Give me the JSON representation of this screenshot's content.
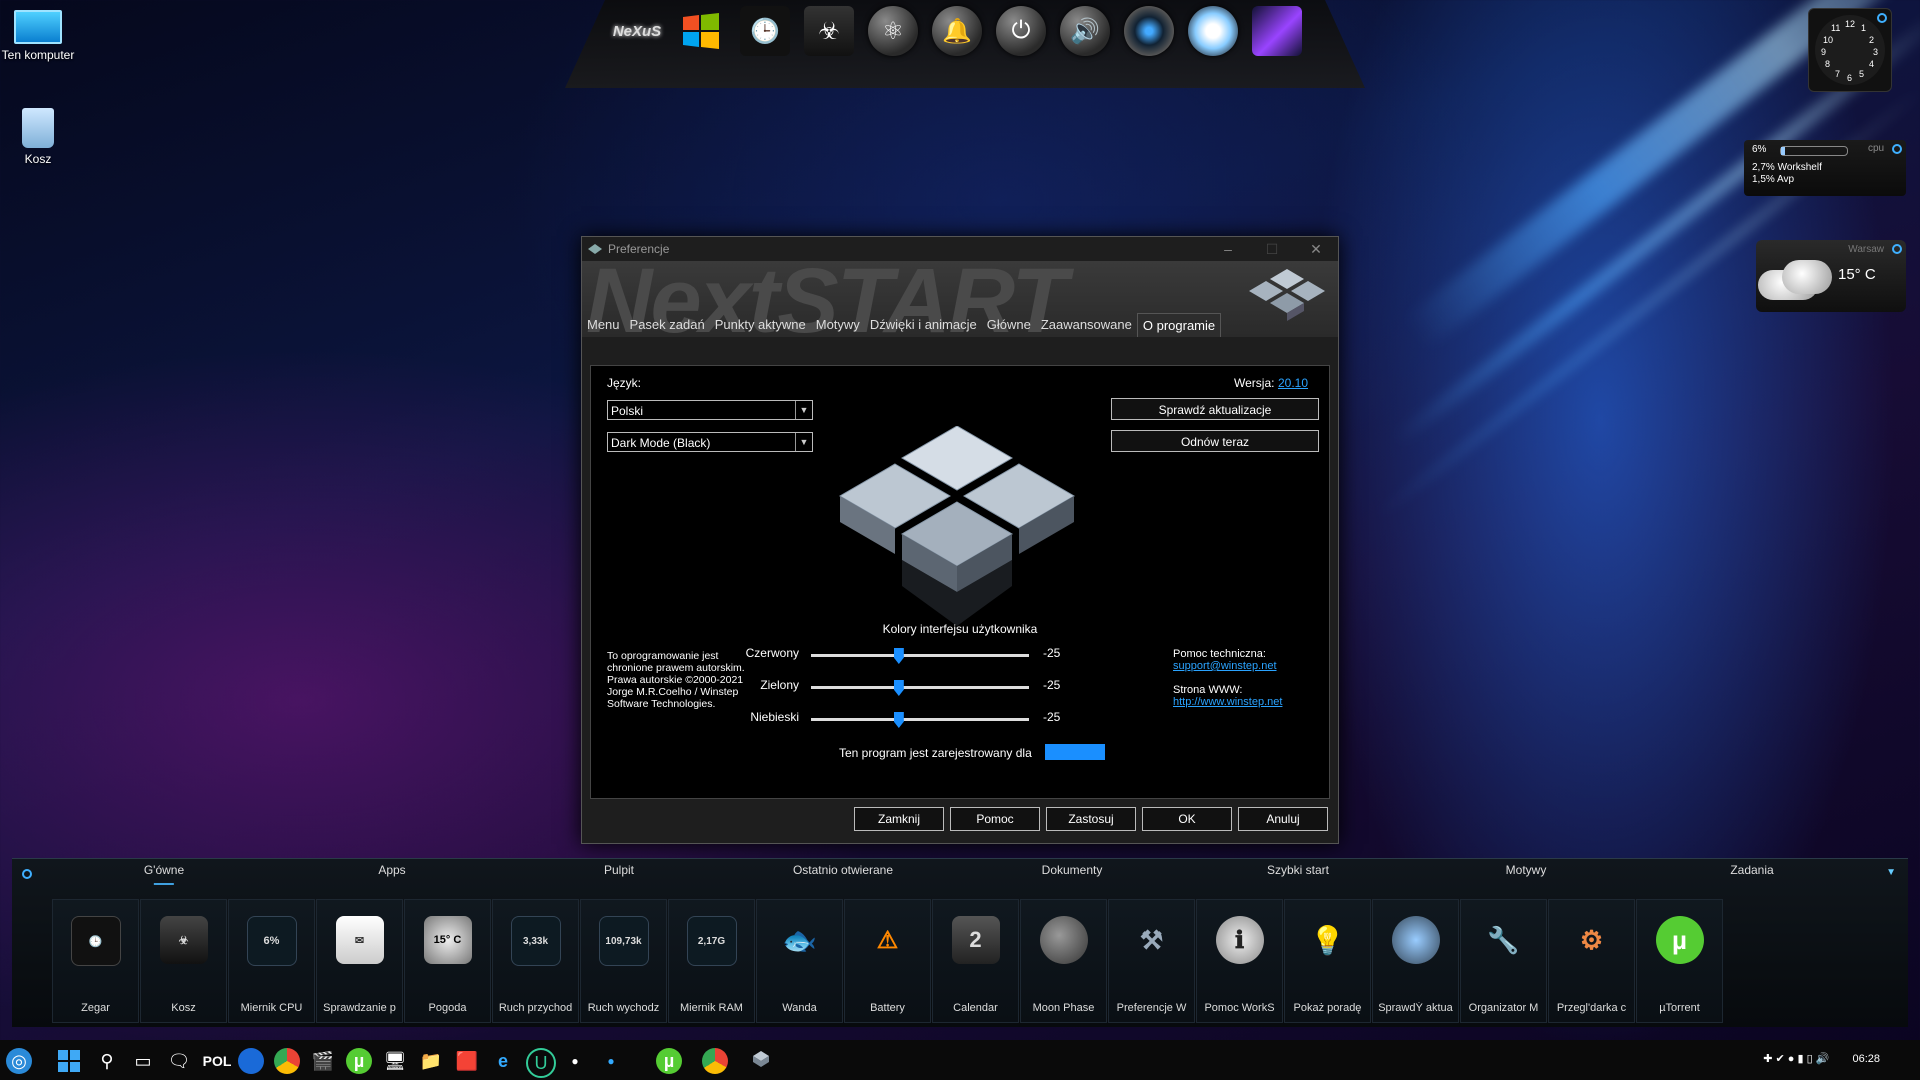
{
  "desktop": {
    "icons": [
      {
        "label": "Ten komputer"
      },
      {
        "label": "Kosz"
      }
    ]
  },
  "top_dock": {
    "items": [
      "Nexus",
      "Windows",
      "Clock",
      "Recycle",
      "Atom",
      "Bell",
      "Power",
      "Speaker",
      "Camera",
      "Compass",
      "Comet"
    ],
    "nexus_label": "NeXuS"
  },
  "clock_gadget": {
    "numbers": [
      "12",
      "1",
      "2",
      "3",
      "4",
      "5",
      "6",
      "7",
      "8",
      "9",
      "10",
      "11"
    ]
  },
  "cpu_gadget": {
    "percent": "6%",
    "title": "cpu",
    "line1": "2,7% Workshelf",
    "line2": "1,5% Avp"
  },
  "weather_gadget": {
    "city": "Warsaw",
    "temp": "15° C"
  },
  "preferences": {
    "title": "Preferencje",
    "banner": "NextSTART",
    "tabs": [
      "Menu",
      "Pasek zadań",
      "Punkty aktywne",
      "Motywy",
      "Dźwięki i animacje",
      "Główne",
      "Zaawansowane",
      "O programie"
    ],
    "active_tab": "O programie",
    "language_label": "Język:",
    "language_value": "Polski",
    "theme_value": "Dark Mode (Black)",
    "version_label": "Wersja:",
    "version_value": "20.10",
    "check_updates": "Sprawdź aktualizacje",
    "renew_now": "Odnów teraz",
    "ui_colors_label": "Kolory interfejsu użytkownika",
    "sliders": [
      {
        "label": "Czerwony",
        "value": "-25",
        "level": 0.38
      },
      {
        "label": "Zielony",
        "value": "-25",
        "level": 0.38
      },
      {
        "label": "Niebieski",
        "value": "-25",
        "level": 0.38
      }
    ],
    "copyright": "To oprogramowanie jest chronione prawem autorskim. Prawa autorskie ©2000-2021 Jorge M.R.Coelho / Winstep Software Technologies.",
    "support_label": "Pomoc techniczna:",
    "support_link": "support@winstep.net",
    "www_label": "Strona WWW:",
    "www_link": "http://www.winstep.net",
    "registered": "Ten program jest zarejestrowany dla",
    "buttons": [
      "Zamknij",
      "Pomoc",
      "Zastosuj",
      "OK",
      "Anuluj"
    ],
    "accent": "#1a8fff"
  },
  "shelf": {
    "tabs": [
      "G'ówne",
      "Apps",
      "Pulpit",
      "Ostatnio otwierane",
      "Dokumenty",
      "Szybki start",
      "Motywy",
      "Zadania"
    ],
    "active_tab": "G'ówne",
    "tiles": [
      {
        "label": "Zegar",
        "badge": ""
      },
      {
        "label": "Kosz",
        "badge": ""
      },
      {
        "label": "Miernik CPU",
        "badge": "6%"
      },
      {
        "label": "Sprawdzanie p",
        "badge": ""
      },
      {
        "label": "Pogoda",
        "badge": "15° C"
      },
      {
        "label": "Ruch przychod",
        "badge": "3,33k"
      },
      {
        "label": "Ruch wychodz",
        "badge": "109,73k"
      },
      {
        "label": "Miernik RAM",
        "badge": "2,17G"
      },
      {
        "label": "Wanda",
        "badge": ""
      },
      {
        "label": "Battery",
        "badge": ""
      },
      {
        "label": "Calendar",
        "badge": "2"
      },
      {
        "label": "Moon Phase",
        "badge": ""
      },
      {
        "label": "Preferencje W",
        "badge": ""
      },
      {
        "label": "Pomoc WorkS",
        "badge": ""
      },
      {
        "label": "Pokaż poradę",
        "badge": ""
      },
      {
        "label": "SprawdÝ aktua",
        "badge": ""
      },
      {
        "label": "Organizator M",
        "badge": ""
      },
      {
        "label": "Przegl'darka c",
        "badge": ""
      },
      {
        "label": "µTorrent",
        "badge": ""
      }
    ]
  },
  "taskbar": {
    "lang": "POL",
    "time": "06:28"
  }
}
